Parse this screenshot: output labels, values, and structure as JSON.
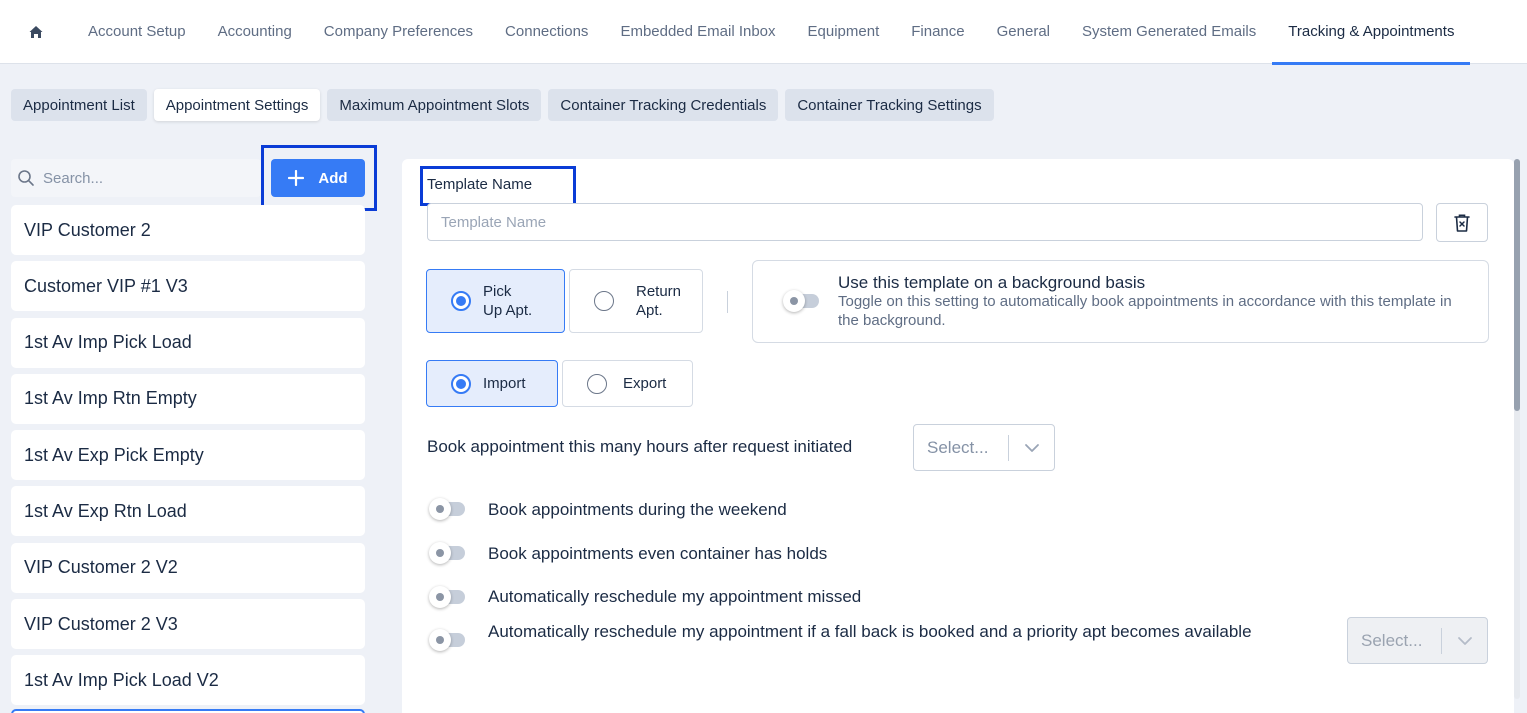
{
  "nav": {
    "tabs": [
      {
        "label": "Account Setup"
      },
      {
        "label": "Accounting"
      },
      {
        "label": "Company Preferences"
      },
      {
        "label": "Connections"
      },
      {
        "label": "Embedded Email Inbox"
      },
      {
        "label": "Equipment"
      },
      {
        "label": "Finance"
      },
      {
        "label": "General"
      },
      {
        "label": "System Generated Emails"
      },
      {
        "label": "Tracking & Appointments"
      }
    ],
    "active": "Tracking & Appointments"
  },
  "subtabs": {
    "items": [
      {
        "label": "Appointment List"
      },
      {
        "label": "Appointment Settings"
      },
      {
        "label": "Maximum Appointment Slots"
      },
      {
        "label": "Container Tracking Credentials"
      },
      {
        "label": "Container Tracking Settings"
      }
    ],
    "active": "Appointment Settings"
  },
  "sidebar": {
    "search_placeholder": "Search...",
    "add_label": "Add",
    "templates": [
      {
        "name": "VIP Customer 2"
      },
      {
        "name": "Customer VIP #1 V3"
      },
      {
        "name": "1st Av Imp Pick Load"
      },
      {
        "name": "1st Av Imp Rtn Empty"
      },
      {
        "name": "1st Av Exp Pick Empty"
      },
      {
        "name": "1st Av Exp Rtn Load"
      },
      {
        "name": "VIP Customer 2 V2"
      },
      {
        "name": "VIP Customer 2 V3"
      },
      {
        "name": "1st Av Imp Pick Load V2"
      }
    ]
  },
  "form": {
    "template_name_label": "Template Name",
    "template_name_placeholder": "Template Name",
    "template_name_value": "",
    "move_type": {
      "options": [
        {
          "line1": "Pick",
          "line2": "Up Apt.",
          "selected": true
        },
        {
          "line1": "Return",
          "line2": "Apt.",
          "selected": false
        }
      ]
    },
    "background": {
      "title": "Use this template on a background basis",
      "description": "Toggle on this setting to automatically book appointments in accordance with this template in the background.",
      "enabled": false
    },
    "direction": {
      "options": [
        {
          "label": "Import",
          "selected": true
        },
        {
          "label": "Export",
          "selected": false
        }
      ]
    },
    "hours_label": "Book appointment this many hours after request initiated",
    "hours_select_placeholder": "Select...",
    "toggles": [
      {
        "label": "Book appointments during the weekend",
        "enabled": false
      },
      {
        "label": "Book appointments even container has holds",
        "enabled": false
      },
      {
        "label": "Automatically reschedule my appointment missed",
        "enabled": false
      },
      {
        "label": "Automatically reschedule my appointment if a fall back is booked and a priority apt becomes available",
        "enabled": false
      }
    ],
    "fallback_select_placeholder": "Select..."
  },
  "colors": {
    "accent": "#367bf5",
    "highlight": "#0a3cd6",
    "text": "#1b2b44",
    "muted": "#5f6d84"
  }
}
